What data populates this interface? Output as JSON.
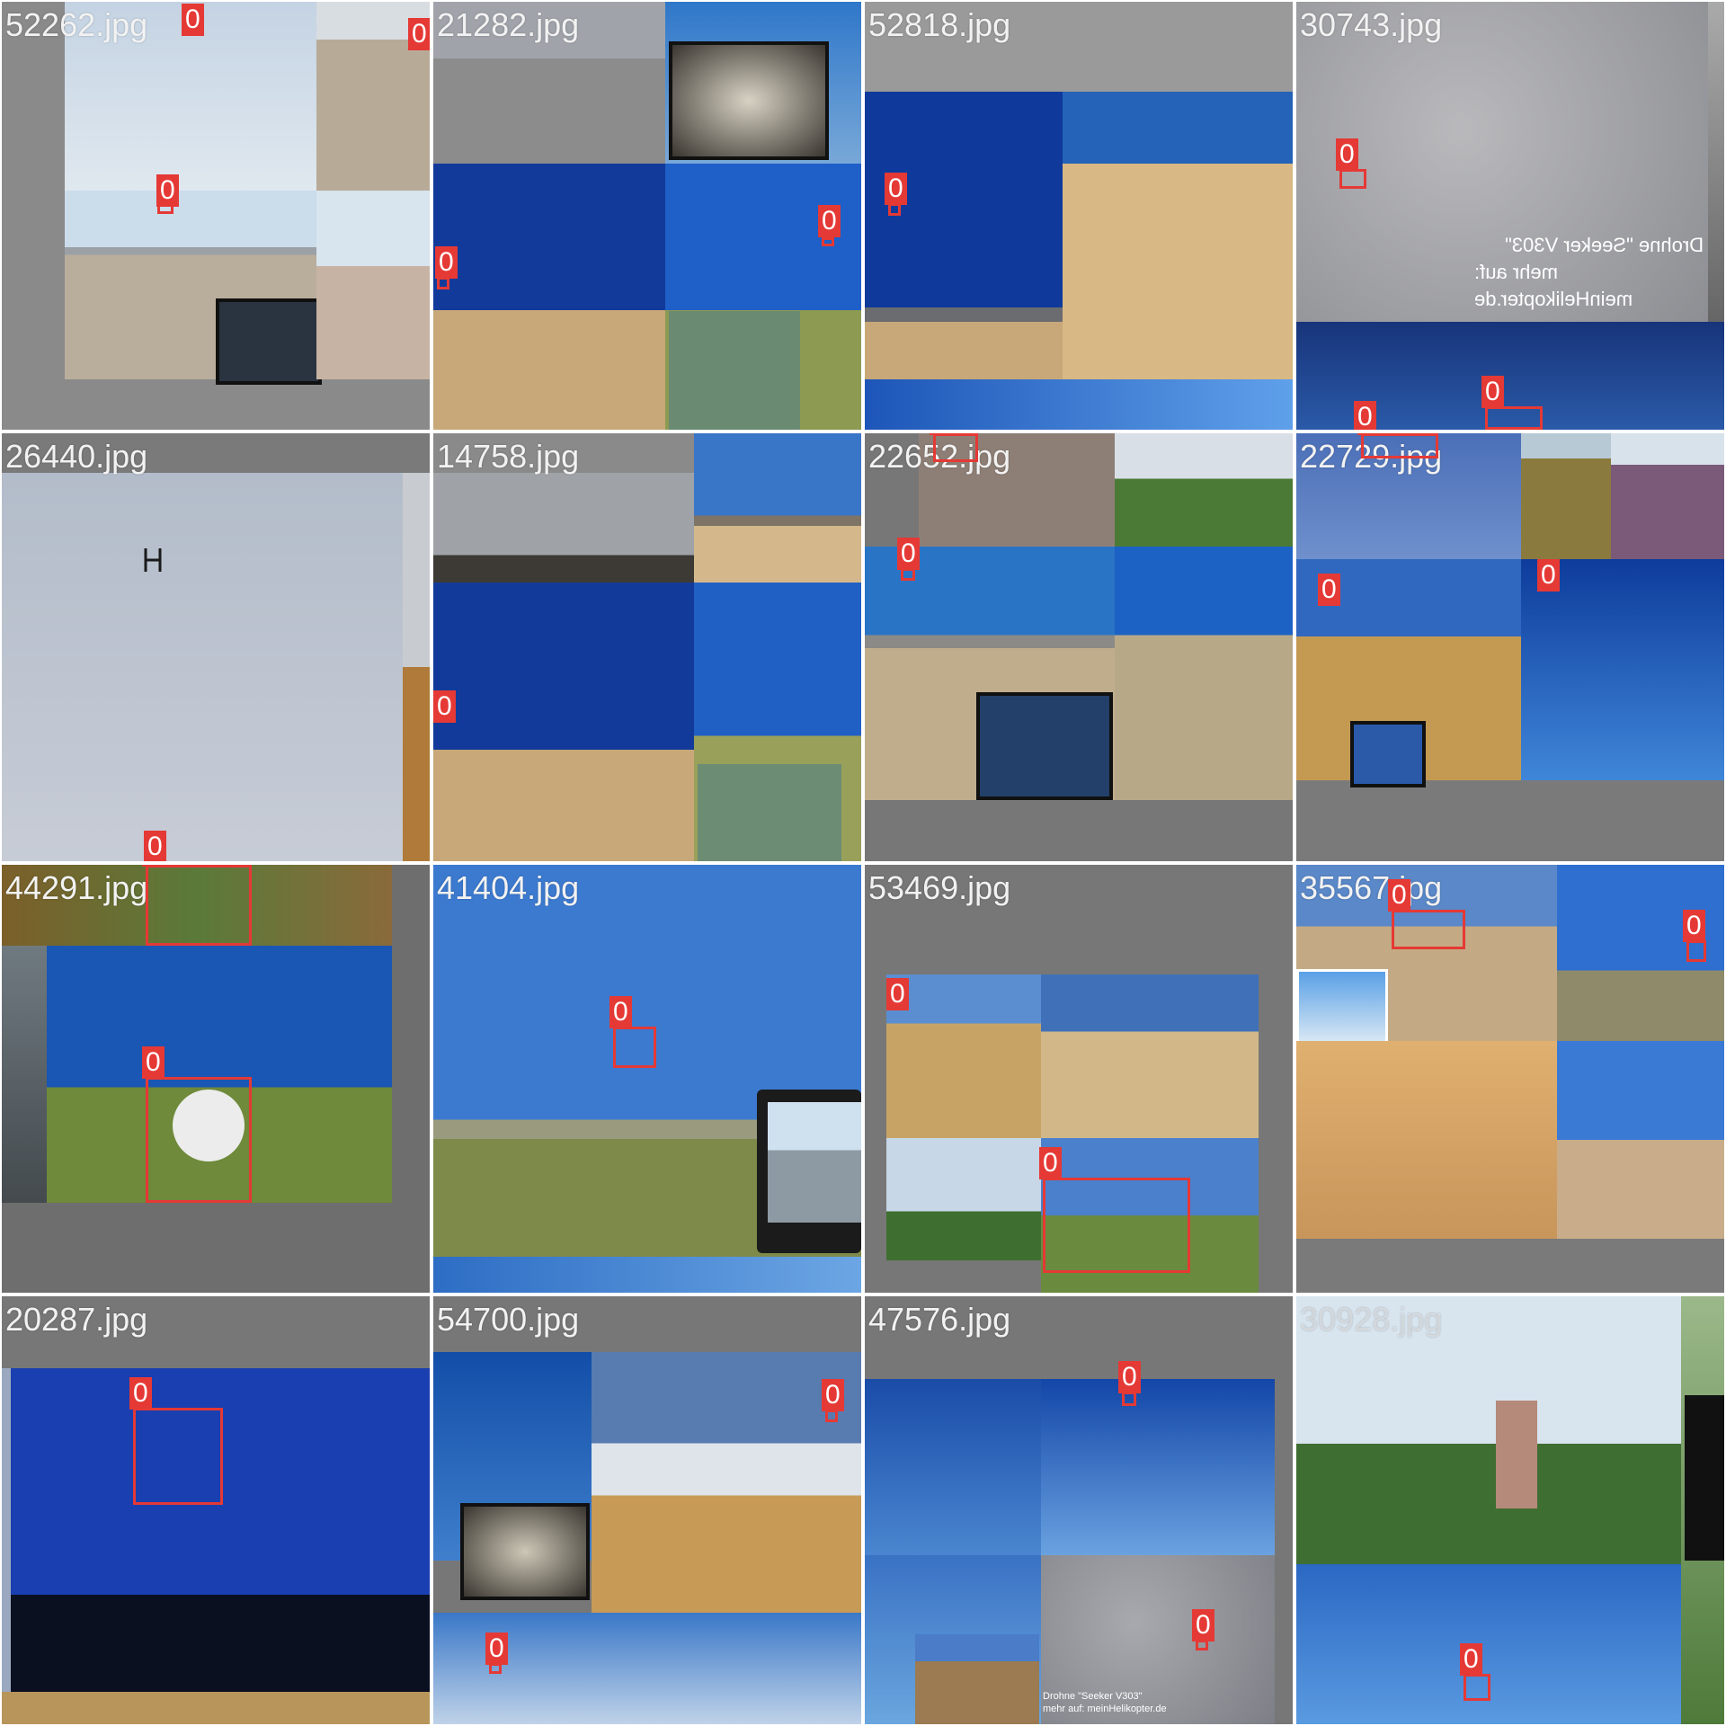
{
  "mosaic": {
    "class_label": "0",
    "tiles": [
      {
        "name": "52262.jpg",
        "labels": [
          "0",
          "0",
          "0"
        ]
      },
      {
        "name": "21282.jpg",
        "labels": [
          "0",
          "0"
        ]
      },
      {
        "name": "52818.jpg",
        "labels": [
          "0"
        ]
      },
      {
        "name": "30743.jpg",
        "labels": [
          "0",
          "0",
          "0"
        ],
        "overlay_line1": "Drohne \"Seeker V303\"",
        "overlay_line2": "mehr auf: meinHelikopter.de"
      },
      {
        "name": "26440.jpg",
        "labels": [
          "0"
        ]
      },
      {
        "name": "14758.jpg",
        "labels": [
          "0"
        ]
      },
      {
        "name": "22652.jpg",
        "labels": [
          "0",
          "0"
        ]
      },
      {
        "name": "22729.jpg",
        "labels": [
          "0",
          "0",
          "0"
        ]
      },
      {
        "name": "44291.jpg",
        "labels": [
          "0",
          "0"
        ]
      },
      {
        "name": "41404.jpg",
        "labels": [
          "0"
        ]
      },
      {
        "name": "53469.jpg",
        "labels": [
          "0",
          "0"
        ]
      },
      {
        "name": "35567.jpg",
        "labels": [
          "0",
          "0"
        ]
      },
      {
        "name": "20287.jpg",
        "labels": [
          "0"
        ]
      },
      {
        "name": "54700.jpg",
        "labels": [
          "0",
          "0"
        ]
      },
      {
        "name": "47576.jpg",
        "labels": [
          "0",
          "0"
        ],
        "overlay_line1": "Drohne \"Seeker V303\"",
        "overlay_line2": "mehr auf: meinHelikopter.de"
      },
      {
        "name": "30928.jpg",
        "labels": [
          "0"
        ]
      }
    ]
  },
  "colors": {
    "box": "#e53935",
    "label_text": "#ffffff",
    "tile_bg": "#777777"
  }
}
